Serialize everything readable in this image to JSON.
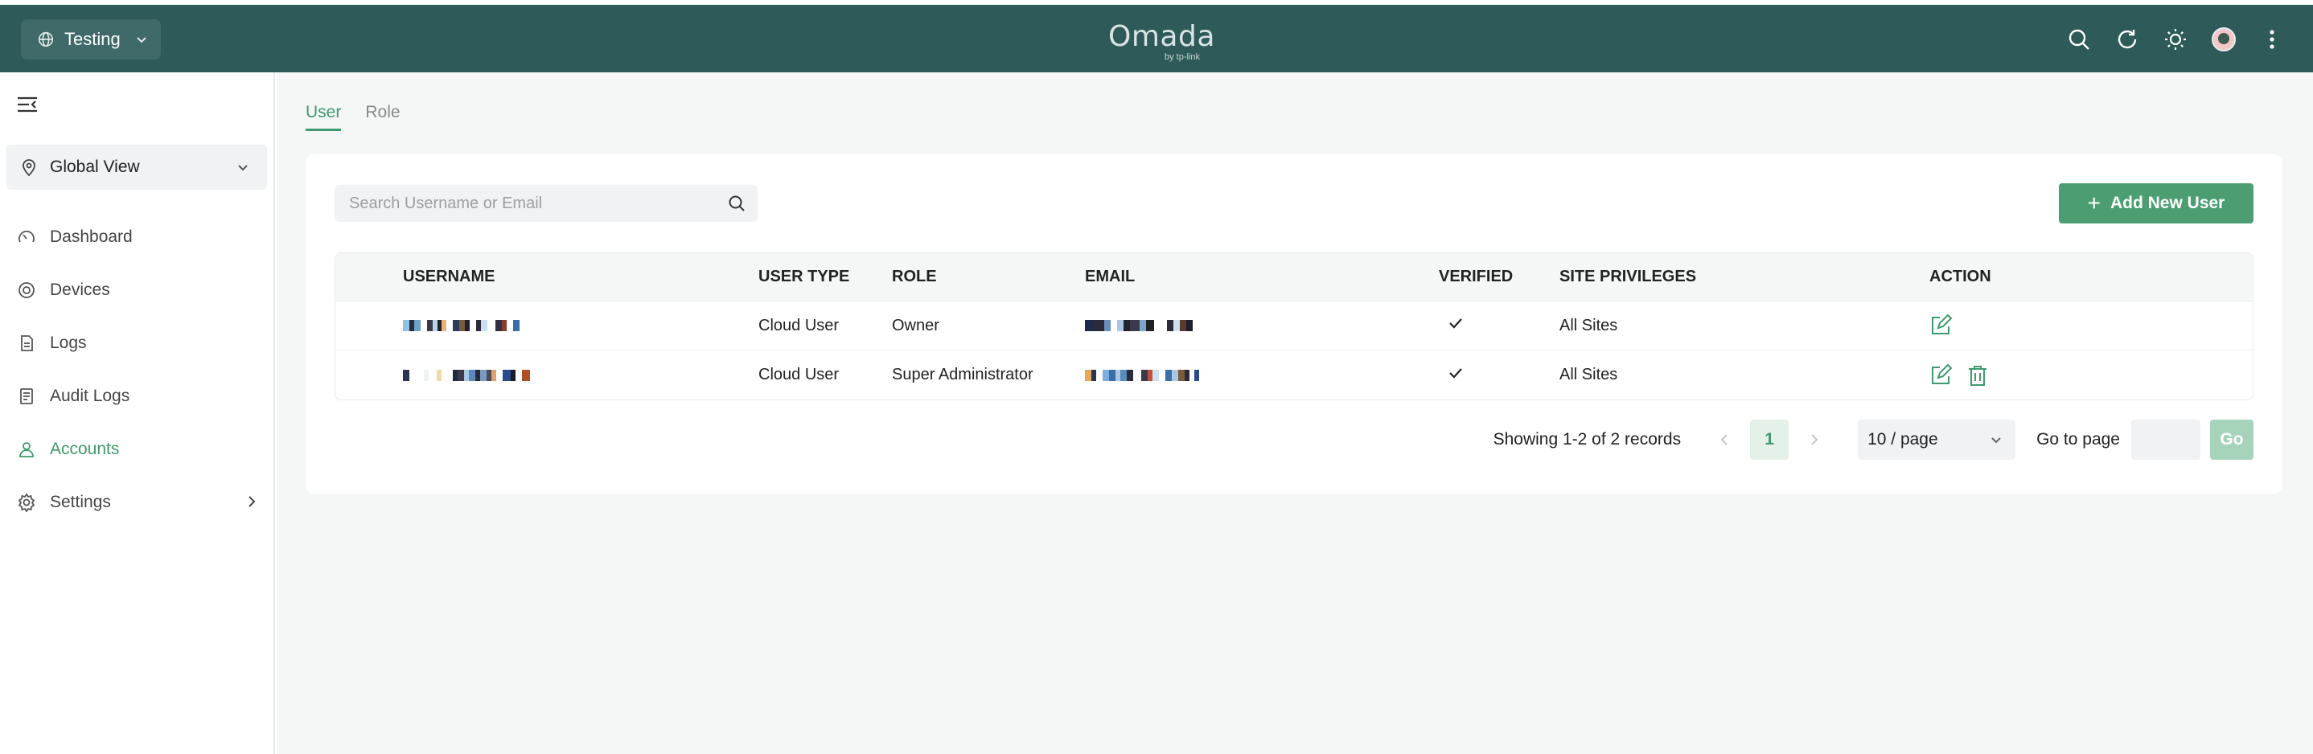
{
  "header": {
    "site_name": "Testing",
    "brand": "Omada",
    "brand_sub": "by tp-link",
    "icons": [
      "search-icon",
      "refresh-icon",
      "theme-sun-icon",
      "user-avatar",
      "more-vertical-icon"
    ]
  },
  "sidebar": {
    "view_label": "Global View",
    "items": [
      {
        "label": "Dashboard",
        "icon": "dashboard-icon",
        "active": false
      },
      {
        "label": "Devices",
        "icon": "devices-icon",
        "active": false
      },
      {
        "label": "Logs",
        "icon": "logs-icon",
        "active": false
      },
      {
        "label": "Audit Logs",
        "icon": "audit-logs-icon",
        "active": false
      },
      {
        "label": "Accounts",
        "icon": "accounts-icon",
        "active": true
      },
      {
        "label": "Settings",
        "icon": "settings-icon",
        "active": false
      }
    ]
  },
  "tabs": [
    {
      "label": "User",
      "active": true
    },
    {
      "label": "Role",
      "active": false
    }
  ],
  "search": {
    "placeholder": "Search Username or Email"
  },
  "add_button": {
    "label": "Add New User"
  },
  "table": {
    "columns": [
      "USERNAME",
      "USER TYPE",
      "ROLE",
      "EMAIL",
      "VERIFIED",
      "SITE PRIVILEGES",
      "ACTION"
    ],
    "rows": [
      {
        "user_type": "Cloud User",
        "role": "Owner",
        "site_privileges": "All Sites",
        "verified": true,
        "actions": [
          "edit"
        ]
      },
      {
        "user_type": "Cloud User",
        "role": "Super Administrator",
        "site_privileges": "All Sites",
        "verified": true,
        "actions": [
          "edit",
          "delete"
        ]
      }
    ]
  },
  "pagination": {
    "info": "Showing 1-2 of 2 records",
    "current_page": "1",
    "per_page": "10 / page",
    "goto_label": "Go to page",
    "go_label": "Go"
  },
  "colors": {
    "header_bg": "#2e5b5a",
    "accent": "#3e9a6c",
    "button": "#4c9e72"
  }
}
